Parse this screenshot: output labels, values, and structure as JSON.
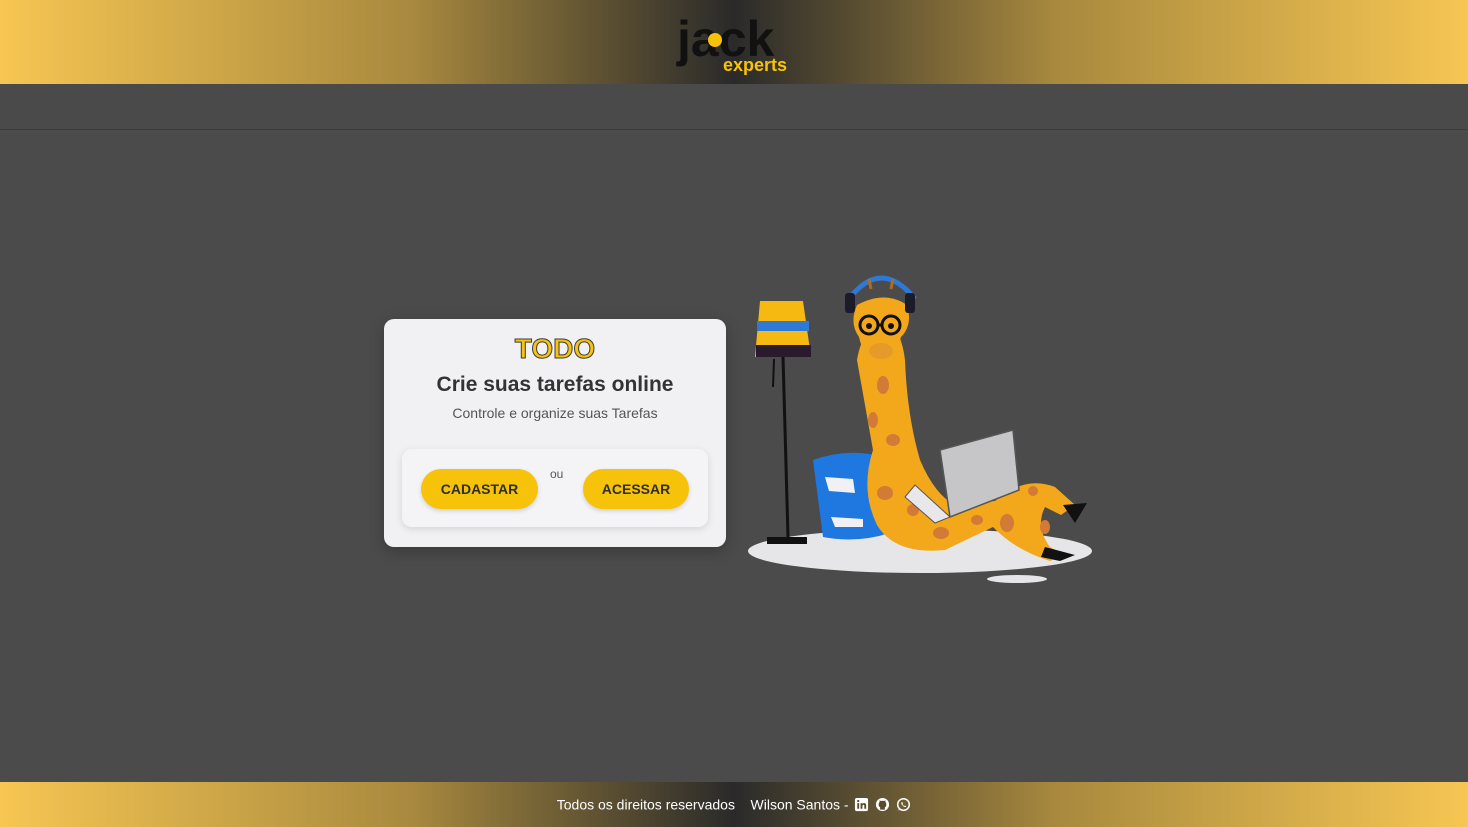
{
  "header": {
    "logo": {
      "word": "jack",
      "sub": "experts"
    }
  },
  "card": {
    "brand": "TODO",
    "title": "Crie suas tarefas online",
    "subtitle": "Controle e organize suas Tarefas",
    "register_label": "CADASTAR",
    "separator": "ou",
    "login_label": "ACESSAR"
  },
  "illustration": {
    "subject": "giraffe-with-laptop-and-lamp"
  },
  "footer": {
    "rights": "Todos os direitos reservados",
    "author": "Wilson Santos -",
    "icons": [
      "linkedin-icon",
      "github-icon",
      "whatsapp-icon"
    ]
  },
  "colors": {
    "accent": "#f7c20a",
    "background": "#4b4b4b",
    "card": "#f1f1f4",
    "gradient_edge": "#f7c653"
  }
}
